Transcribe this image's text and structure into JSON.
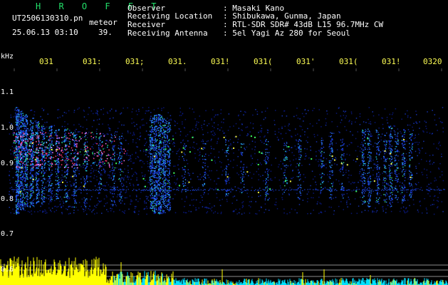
{
  "header": {
    "logo": "H R O F F T",
    "filename": "UT2506130310.pn",
    "tag": "meteor",
    "datetime": "25.06.13 03:10",
    "count": "39.",
    "fields": [
      {
        "label": "Observer",
        "value": ": Masaki Kano"
      },
      {
        "label": "Receiving Location",
        "value": ": Shibukawa, Gunma, Japan"
      },
      {
        "label": "Receiver",
        "value": ": RTL-SDR SDR# 43dB L15 96.7MHz CW"
      },
      {
        "label": "Receiving Antenna",
        "value": ": 5el Yagi Az 280 for Seoul"
      }
    ]
  },
  "y_axis": {
    "unit": "kHz",
    "ticks": [
      "1.1",
      "1.0",
      "0.9",
      "0.8",
      "0.7",
      "0.6"
    ]
  },
  "x_axis": {
    "ticks": [
      "031",
      "031:",
      "031;",
      "031.",
      "031!",
      "031(",
      "031'",
      "031(",
      "031!",
      "0320"
    ]
  },
  "colors": {
    "background": "#000000",
    "logo": "#22e06a",
    "text": "#ffffff",
    "tick_label": "#ffff55",
    "trace": "#ffff00",
    "trace_low": "#00e0ff"
  }
}
